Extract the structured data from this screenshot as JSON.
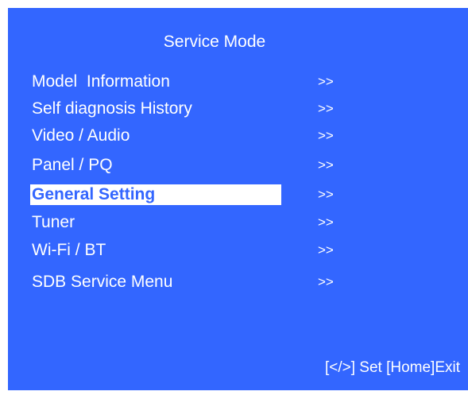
{
  "title": "Service Mode",
  "menu": {
    "items": [
      {
        "label": "Model  Information",
        "arrow": ">>"
      },
      {
        "label": "Self diagnosis History",
        "arrow": ">>"
      },
      {
        "label": "Video / Audio",
        "arrow": ">>"
      },
      {
        "label": "Panel / PQ",
        "arrow": ">>"
      },
      {
        "label": "General Setting",
        "arrow": ">>",
        "selected": true
      },
      {
        "label": "Tuner",
        "arrow": ">>"
      },
      {
        "label": "Wi-Fi / BT",
        "arrow": ">>"
      },
      {
        "label": "SDB Service Menu",
        "arrow": ">>"
      }
    ]
  },
  "footer": "[</>] Set [Home]Exit",
  "colors": {
    "background": "#3366ff",
    "text": "#ffffff",
    "highlight_bg": "#ffffff",
    "highlight_text": "#3366ff"
  }
}
